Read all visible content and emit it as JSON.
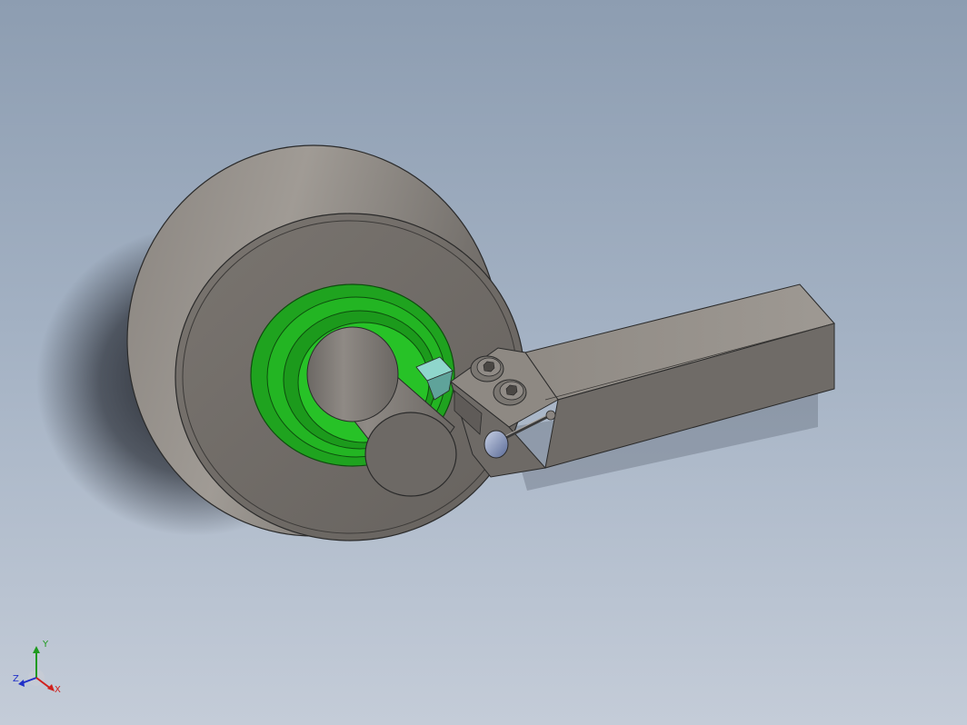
{
  "viewport": {
    "background_top": "#8d9db1",
    "background_bottom": "#c4ccd8"
  },
  "model": {
    "parts": [
      "wheel",
      "bearing",
      "shaft",
      "tool-holder",
      "cutting-insert",
      "cap-screw",
      "cap-screw",
      "clamp-lever"
    ],
    "colors": {
      "wheel": "#8b8580",
      "bearing": "#1fa31f",
      "insert": "#7fc8c0",
      "holder": "#85807a",
      "lever": "#8b9ab8"
    }
  },
  "triad": {
    "x_label": "X",
    "y_label": "Y",
    "z_label": "Z",
    "x_color": "#d0201c",
    "y_color": "#1f9a1f",
    "z_color": "#2030c8"
  }
}
